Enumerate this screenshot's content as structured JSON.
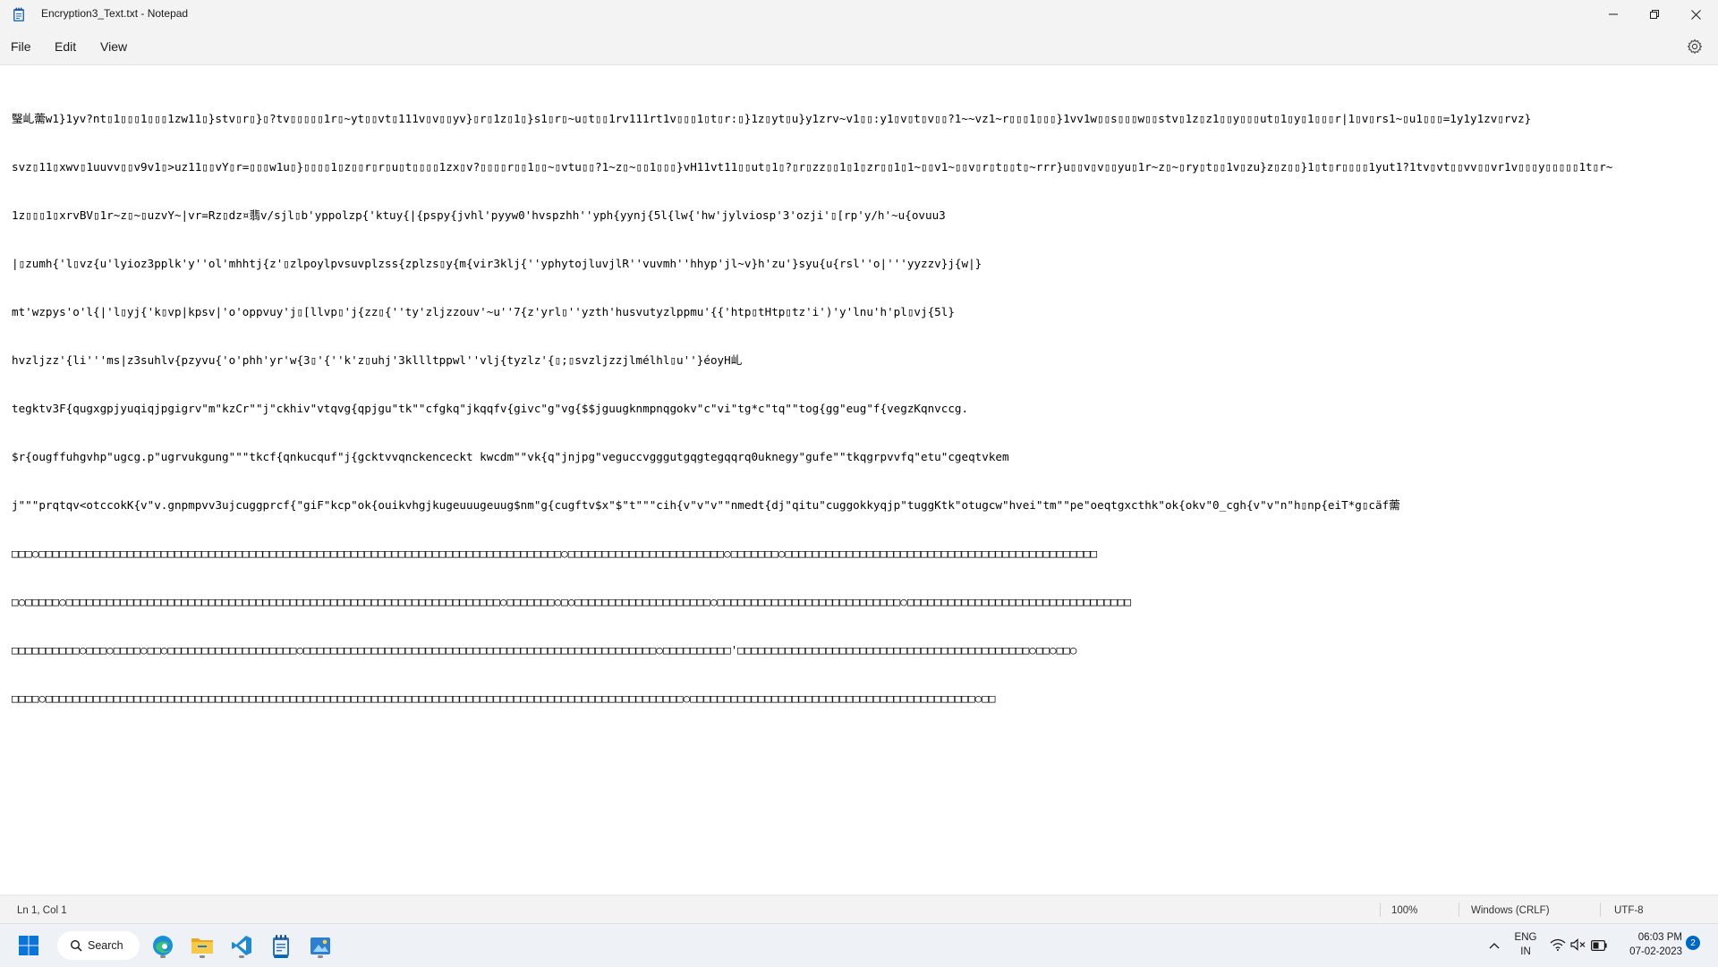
{
  "window": {
    "title": "Encryption3_Text.txt - Notepad"
  },
  "menu": {
    "file": "File",
    "edit": "Edit",
    "view": "View"
  },
  "editor": {
    "lines": [
      "瑿乢薷w1}1yv?nt▯1▯▯▯1▯▯▯1zw11▯}stv▯r▯}▯?tv▯▯▯▯▯1r▯~yt▯▯vt▯111v▯v▯▯yv}▯r▯1z▯1▯}s1▯r▯~u▯t▯▯1rv111rt1v▯▯▯1▯t▯r:▯}1z▯yt▯u}y1zrv~v1▯▯:y1▯v▯t▯v▯▯?1~~vz1~r▯▯▯1▯▯▯}1vv1w▯▯s▯▯▯w▯▯stv▯1z▯z1▯▯y▯▯▯ut▯1▯y▯1▯▯▯r|1▯v▯rs1~▯u1▯▯▯=1y1y1zv▯rvz}",
      "svz▯11▯xwv▯1uuvv▯▯v9v1▯>uz11▯▯vY▯r=▯▯▯w1u▯}▯▯▯▯1▯z▯▯r▯r▯u▯t▯▯▯▯1zx▯v?▯▯▯▯r▯▯1▯▯~▯vtu▯▯?1~z▯~▯▯1▯▯▯}vH11vt11▯▯ut▯1▯?▯r▯zz▯▯1▯1▯zr▯▯1▯1~▯▯v1~▯▯v▯r▯t▯▯t▯~rrr}u▯▯v▯v▯▯yu▯1r~z▯~▯ry▯t▯▯1v▯zu}z▯z▯▯}1▯t▯r▯▯▯▯1yut1?1tv▯vt▯▯vv▯▯vr1v▯▯▯y▯▯▯▯▯1t▯r~",
      "1z▯▯▯1▯xrvBV▯1r~z▯~▯uzvY~|vr=Rz▯dz¤翡v/sjl▯b'yppolzp{'ktuy{|{pspy{jvhl'pyyw0'hvspzhh''yph{yynj{5l{lw{'hw'jylviosp'3'ozji'▯[rp'y/h'~u{ovuu3",
      "|▯zumh{'l▯vz{u'lyioz3pplk'y''ol'mhhtj{z'▯zlpoylpvsuvplzss{zplzs▯y{m{vir3klj{''yphytojluvjlR''vuvmh''hhyp'jl~v}h'zu'}syu{u{rsl''o|'''yyzzv}j{w|}",
      "mt'wzpys'o'l{|'l▯yj{'k▯vp|kpsv|'o'oppvuy'j▯[llvp▯'j{zz▯{''ty'zljzzouv'~u''7{z'yrl▯''yzth'husvutyzlppmu'{{'htp▯tHtp▯tz'i')'y'lnu'h'pl▯vj{5l}",
      "hvzljzz'{li'''ms|z3suhlv{pzyvu{'o'phh'yr'w{3▯'{''k'z▯uhj'3kllltppwl''vlj{tyzlz'{▯;▯svzljzzjlmélhl▯u''}éoyH乢",
      "tegktv3F{qugxgpjyuqiqjpgigrv\"m\"kzCr\"\"j\"ckhiv\"vtqvg{qpjgu\"tk\"\"cfgkq\"jkqqfv{givc\"g\"vg{$$jguugknmpnqgokv\"c\"vi\"tg*c\"tq\"\"tog{gg\"eug\"f{vegzKqnvccg.",
      "$r{ougffuhgvhp\"ugcg.p\"ugrvukgung\"\"\"tkcf{qnkucquf\"j{gcktvvqnckenceckt kwcdm\"\"vk{q\"jnjpg\"veguccvgggutgqgtegqqrq0uknegy\"gufe\"\"tkqgrpvvfq\"etu\"cgeqtvkem",
      "j\"\"\"prqtqv<otccokK{v\"v.gnpmpvv3ujcuggprcf{\"giF\"kcp\"ok{ouikvhgjkugeuuugeuug$nm\"g{cugftv$x\"$\"t\"\"\"cih{v\"v\"v\"\"nmedt{dj\"qitu\"cuggokkyqjp\"tuggKtk\"otugcw\"hvei\"tm\"\"pe\"oeqtgxcthk\"ok{okv\"0_cgh{v\"v\"n\"h▯np{eiT*g▯cäf薷",
      "□□□○□□□□□□□□□□□□□□□□□□□□□□□□□□□□□□□□□□□□□□□□□□□□□□□□□□□□□□□□□□□□□□□□□□□□□□□□□□□□□○□□□□□□□□□□□□□□□□□□□□□□□○□□□□□□□○□□□□□□□□□□□□□□□□□□□□□□□□□□□□□□□□□□□□□□□□□□□□□□",
      "□○□□□□□○□□□□□□□□□□□□□□□□□□□□□□□□□□□□□□□□□□□□□□□□□□□□□□□□□□□□□□□□□□□□□□□□○□□□□□□□○□○□□□□□□□□□□□□□□□□□□□□○□□□□□□□□□□□□□□□□□□□□□□□□□□□○□□□□□□□□□□□□□□□□□□□□□□□□□□□□□□□□□",
      "□□□□□□□□□□○□□□○□□□□○□□○□□□□□□□□□□□□□□□□□□□○□□□□□□□□□□□□□□□□□□□□□□□□□□□□□□□□□□□□□□□□□□□□□□□□□□□□○□□□□□□□□□□'□□□□□□□□□□□□□□□□□□□□□□□□□□□□□□□□□□□□□□□□□□□○□□○□□○",
      "□□□□○□□□□□□□□□□□□□□□□□□□□□□□□□□□□□□□□□□□□□□□□□□□□□□□□□□□□□□□□□□□□□□□□□□□□□□□□□□□□□□□□□□□□□□□□□□□□□□○□□□□□□□□□□□□□□□□□□□□□□□□□□□□□□□□□□□□□□□□□□○□□"
    ]
  },
  "status": {
    "position": "Ln 1, Col 1",
    "zoom": "100%",
    "line_ending": "Windows (CRLF)",
    "encoding": "UTF-8"
  },
  "taskbar": {
    "search_label": "Search",
    "lang_top": "ENG",
    "lang_bottom": "IN",
    "time": "06:03 PM",
    "date": "07-02-2023",
    "notification_count": "2"
  }
}
